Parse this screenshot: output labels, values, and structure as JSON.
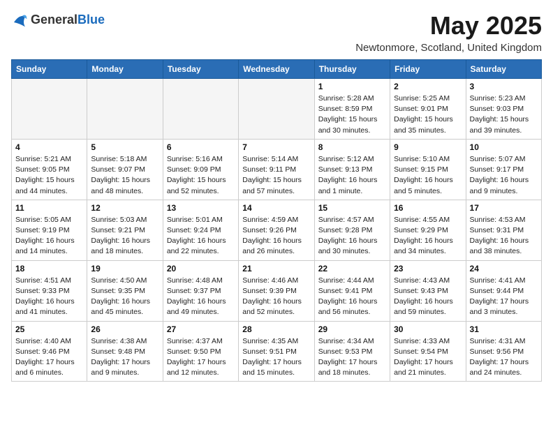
{
  "logo": {
    "general": "General",
    "blue": "Blue"
  },
  "title": "May 2025",
  "location": "Newtonmore, Scotland, United Kingdom",
  "days_of_week": [
    "Sunday",
    "Monday",
    "Tuesday",
    "Wednesday",
    "Thursday",
    "Friday",
    "Saturday"
  ],
  "weeks": [
    [
      {
        "num": "",
        "info": ""
      },
      {
        "num": "",
        "info": ""
      },
      {
        "num": "",
        "info": ""
      },
      {
        "num": "",
        "info": ""
      },
      {
        "num": "1",
        "info": "Sunrise: 5:28 AM\nSunset: 8:59 PM\nDaylight: 15 hours\nand 30 minutes."
      },
      {
        "num": "2",
        "info": "Sunrise: 5:25 AM\nSunset: 9:01 PM\nDaylight: 15 hours\nand 35 minutes."
      },
      {
        "num": "3",
        "info": "Sunrise: 5:23 AM\nSunset: 9:03 PM\nDaylight: 15 hours\nand 39 minutes."
      }
    ],
    [
      {
        "num": "4",
        "info": "Sunrise: 5:21 AM\nSunset: 9:05 PM\nDaylight: 15 hours\nand 44 minutes."
      },
      {
        "num": "5",
        "info": "Sunrise: 5:18 AM\nSunset: 9:07 PM\nDaylight: 15 hours\nand 48 minutes."
      },
      {
        "num": "6",
        "info": "Sunrise: 5:16 AM\nSunset: 9:09 PM\nDaylight: 15 hours\nand 52 minutes."
      },
      {
        "num": "7",
        "info": "Sunrise: 5:14 AM\nSunset: 9:11 PM\nDaylight: 15 hours\nand 57 minutes."
      },
      {
        "num": "8",
        "info": "Sunrise: 5:12 AM\nSunset: 9:13 PM\nDaylight: 16 hours\nand 1 minute."
      },
      {
        "num": "9",
        "info": "Sunrise: 5:10 AM\nSunset: 9:15 PM\nDaylight: 16 hours\nand 5 minutes."
      },
      {
        "num": "10",
        "info": "Sunrise: 5:07 AM\nSunset: 9:17 PM\nDaylight: 16 hours\nand 9 minutes."
      }
    ],
    [
      {
        "num": "11",
        "info": "Sunrise: 5:05 AM\nSunset: 9:19 PM\nDaylight: 16 hours\nand 14 minutes."
      },
      {
        "num": "12",
        "info": "Sunrise: 5:03 AM\nSunset: 9:21 PM\nDaylight: 16 hours\nand 18 minutes."
      },
      {
        "num": "13",
        "info": "Sunrise: 5:01 AM\nSunset: 9:24 PM\nDaylight: 16 hours\nand 22 minutes."
      },
      {
        "num": "14",
        "info": "Sunrise: 4:59 AM\nSunset: 9:26 PM\nDaylight: 16 hours\nand 26 minutes."
      },
      {
        "num": "15",
        "info": "Sunrise: 4:57 AM\nSunset: 9:28 PM\nDaylight: 16 hours\nand 30 minutes."
      },
      {
        "num": "16",
        "info": "Sunrise: 4:55 AM\nSunset: 9:29 PM\nDaylight: 16 hours\nand 34 minutes."
      },
      {
        "num": "17",
        "info": "Sunrise: 4:53 AM\nSunset: 9:31 PM\nDaylight: 16 hours\nand 38 minutes."
      }
    ],
    [
      {
        "num": "18",
        "info": "Sunrise: 4:51 AM\nSunset: 9:33 PM\nDaylight: 16 hours\nand 41 minutes."
      },
      {
        "num": "19",
        "info": "Sunrise: 4:50 AM\nSunset: 9:35 PM\nDaylight: 16 hours\nand 45 minutes."
      },
      {
        "num": "20",
        "info": "Sunrise: 4:48 AM\nSunset: 9:37 PM\nDaylight: 16 hours\nand 49 minutes."
      },
      {
        "num": "21",
        "info": "Sunrise: 4:46 AM\nSunset: 9:39 PM\nDaylight: 16 hours\nand 52 minutes."
      },
      {
        "num": "22",
        "info": "Sunrise: 4:44 AM\nSunset: 9:41 PM\nDaylight: 16 hours\nand 56 minutes."
      },
      {
        "num": "23",
        "info": "Sunrise: 4:43 AM\nSunset: 9:43 PM\nDaylight: 16 hours\nand 59 minutes."
      },
      {
        "num": "24",
        "info": "Sunrise: 4:41 AM\nSunset: 9:44 PM\nDaylight: 17 hours\nand 3 minutes."
      }
    ],
    [
      {
        "num": "25",
        "info": "Sunrise: 4:40 AM\nSunset: 9:46 PM\nDaylight: 17 hours\nand 6 minutes."
      },
      {
        "num": "26",
        "info": "Sunrise: 4:38 AM\nSunset: 9:48 PM\nDaylight: 17 hours\nand 9 minutes."
      },
      {
        "num": "27",
        "info": "Sunrise: 4:37 AM\nSunset: 9:50 PM\nDaylight: 17 hours\nand 12 minutes."
      },
      {
        "num": "28",
        "info": "Sunrise: 4:35 AM\nSunset: 9:51 PM\nDaylight: 17 hours\nand 15 minutes."
      },
      {
        "num": "29",
        "info": "Sunrise: 4:34 AM\nSunset: 9:53 PM\nDaylight: 17 hours\nand 18 minutes."
      },
      {
        "num": "30",
        "info": "Sunrise: 4:33 AM\nSunset: 9:54 PM\nDaylight: 17 hours\nand 21 minutes."
      },
      {
        "num": "31",
        "info": "Sunrise: 4:31 AM\nSunset: 9:56 PM\nDaylight: 17 hours\nand 24 minutes."
      }
    ]
  ]
}
